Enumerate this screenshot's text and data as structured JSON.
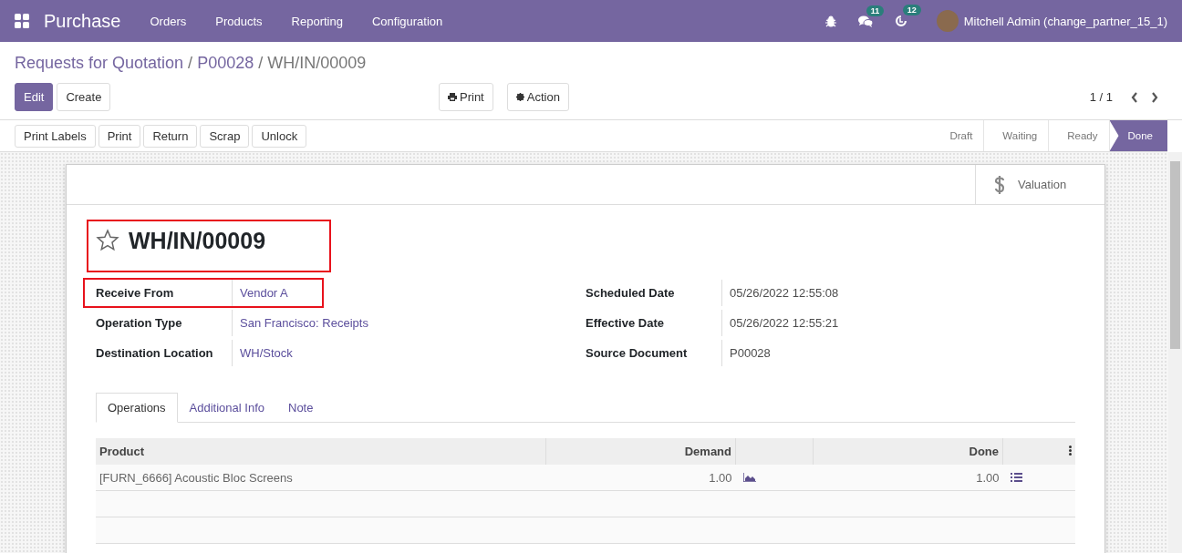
{
  "navbar": {
    "app_name": "Purchase",
    "menu": [
      "Orders",
      "Products",
      "Reporting",
      "Configuration"
    ],
    "systray": [
      {
        "kind": "bug"
      },
      {
        "kind": "chat",
        "badge": "11"
      },
      {
        "kind": "activity",
        "badge": "12"
      }
    ],
    "user": "Mitchell Admin (change_partner_15_1)"
  },
  "breadcrumb_separator": "/",
  "breadcrumb": [
    {
      "label": "Requests for Quotation",
      "current": false
    },
    {
      "label": "P00028",
      "current": false
    },
    {
      "label": "WH/IN/00009",
      "current": true
    }
  ],
  "main_buttons": [
    {
      "label": "Edit",
      "primary": true
    },
    {
      "label": "Create",
      "primary": false
    }
  ],
  "action_buttons": [
    {
      "label": "Print",
      "kind": "print"
    },
    {
      "label": "Action",
      "kind": "gear"
    }
  ],
  "pager": "1 / 1",
  "header_buttons": [
    "Print Labels",
    "Print",
    "Return",
    "Scrap",
    "Unlock"
  ],
  "status_steps": [
    {
      "label": "Draft",
      "selected": false
    },
    {
      "label": "Waiting",
      "selected": false
    },
    {
      "label": "Ready",
      "selected": false
    },
    {
      "label": "Done",
      "selected": true
    }
  ],
  "smart_button": {
    "label": "Valuation"
  },
  "record": {
    "title": "WH/IN/00009",
    "starred": false,
    "highlighted": true
  },
  "fields_left": [
    {
      "label": "Receive From",
      "value": "Vendor A",
      "link": true,
      "highlighted": true
    },
    {
      "label": "Operation Type",
      "value": "San Francisco: Receipts",
      "link": true,
      "highlighted": false
    },
    {
      "label": "Destination Location",
      "value": "WH/Stock",
      "link": true,
      "highlighted": false
    }
  ],
  "fields_right": [
    {
      "label": "Scheduled Date",
      "value": "05/26/2022 12:55:08",
      "link": false,
      "highlighted": false
    },
    {
      "label": "Effective Date",
      "value": "05/26/2022 12:55:21",
      "link": false,
      "highlighted": false
    },
    {
      "label": "Source Document",
      "value": "P00028",
      "link": false,
      "highlighted": false
    }
  ],
  "tabs": [
    {
      "label": "Operations",
      "selected": true
    },
    {
      "label": "Additional Info",
      "selected": false
    },
    {
      "label": "Note",
      "selected": false
    }
  ],
  "table": {
    "columns": [
      "Product",
      "Demand",
      "Done"
    ],
    "rows": [
      {
        "product": "[FURN_6666] Acoustic Bloc Screens",
        "demand": "1.00",
        "done": "1.00"
      }
    ]
  }
}
